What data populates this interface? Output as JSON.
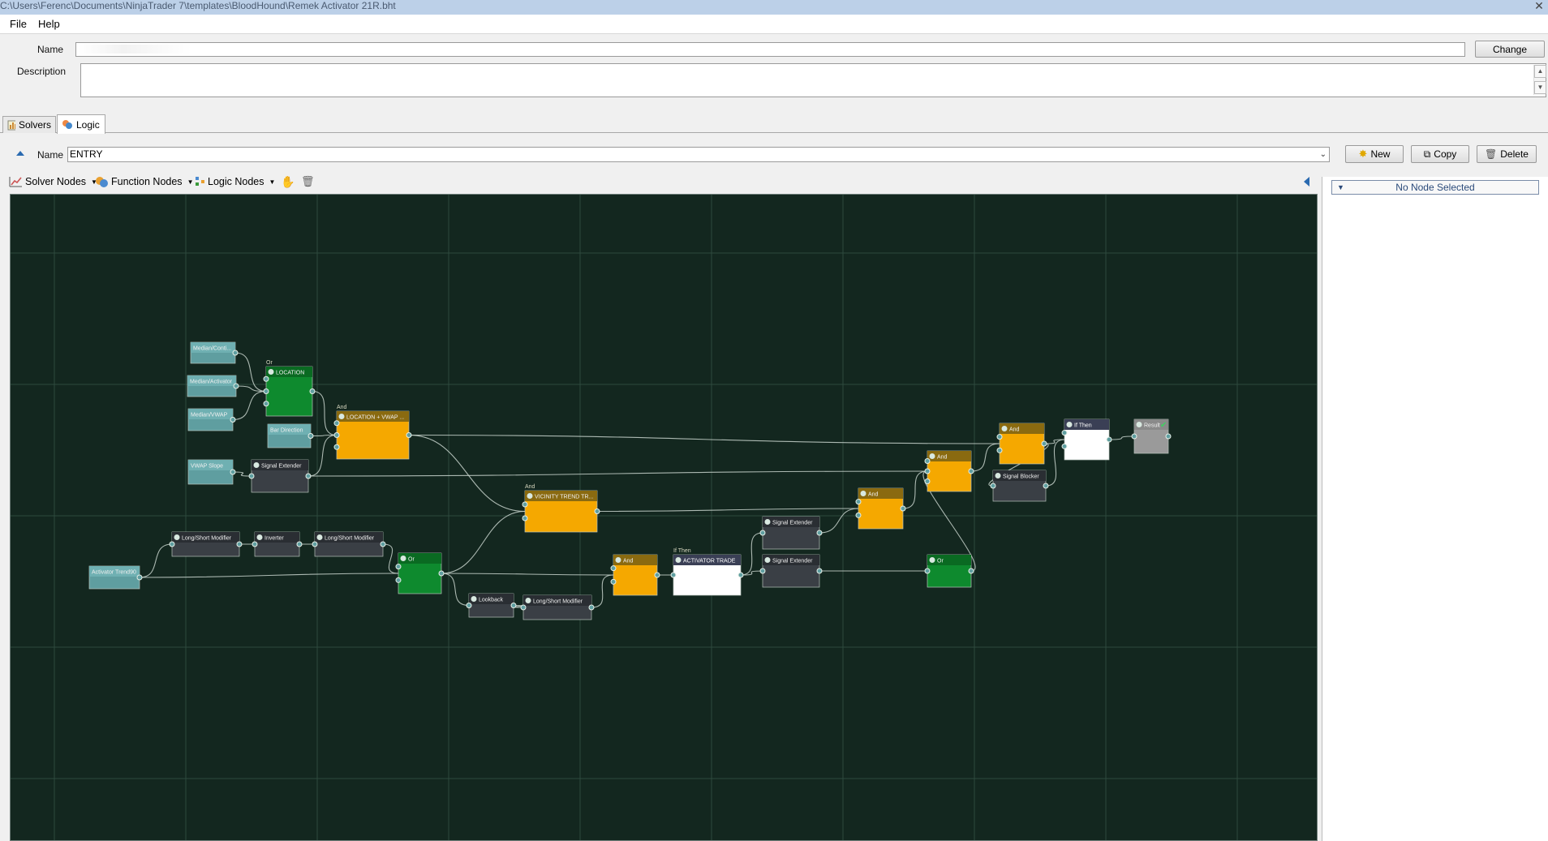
{
  "window": {
    "title": "C:\\Users\\Ferenc\\Documents\\NinjaTrader 7\\templates\\BloodHound\\Remek Activator 21R.bht",
    "close_glyph": "✕"
  },
  "menu": {
    "items": [
      "File",
      "Help"
    ]
  },
  "header": {
    "name_label": "Name",
    "name_value": "",
    "change_label": "Change",
    "description_label": "Description",
    "description_value": ""
  },
  "tabs": [
    {
      "label": "Solvers",
      "active": false
    },
    {
      "label": "Logic",
      "active": true
    }
  ],
  "logic": {
    "name_label": "Name",
    "name_value": "ENTRY",
    "new_label": "New",
    "copy_label": "Copy",
    "delete_label": "Delete"
  },
  "toolbar": {
    "solver_nodes": "Solver Nodes",
    "function_nodes": "Function Nodes",
    "logic_nodes": "Logic Nodes"
  },
  "right_panel": {
    "selection_text": "No Node Selected"
  },
  "colors": {
    "canvas_bg": "#13271f",
    "grid": "#2e4a3e",
    "teal_node": "#5f9ea0",
    "dark_node": "#3a3f45",
    "green_node": "#0e8a2e",
    "orange_node": "#f5a800",
    "white_node": "#ffffff",
    "gray_node": "#9a9a9a",
    "wire": "#c8d4cc"
  },
  "graph": {
    "nodes": [
      {
        "id": "n1",
        "kind": "teal",
        "title": "Median/Conti...",
        "top_label": ""
      },
      {
        "id": "n2",
        "kind": "teal",
        "title": "Median/Activator",
        "top_label": ""
      },
      {
        "id": "n3",
        "kind": "teal",
        "title": "Median/VWAP",
        "top_label": ""
      },
      {
        "id": "n4",
        "kind": "green",
        "title": "LOCATION",
        "top_label": "Or"
      },
      {
        "id": "n5",
        "kind": "teal",
        "title": "Bar Direction",
        "top_label": ""
      },
      {
        "id": "n6",
        "kind": "orange",
        "title": "LOCATION + VWAP ...",
        "top_label": "And"
      },
      {
        "id": "n7",
        "kind": "teal",
        "title": "VWAP Slope",
        "top_label": ""
      },
      {
        "id": "n8",
        "kind": "dark",
        "title": "Signal Extender",
        "top_label": ""
      },
      {
        "id": "n9",
        "kind": "teal",
        "title": "Activator Trend90",
        "top_label": ""
      },
      {
        "id": "n10",
        "kind": "dark",
        "title": "Long/Short Modifier",
        "top_label": ""
      },
      {
        "id": "n11",
        "kind": "dark",
        "title": "Inverter",
        "top_label": ""
      },
      {
        "id": "n12",
        "kind": "dark",
        "title": "Long/Short Modifier",
        "top_label": ""
      },
      {
        "id": "n13",
        "kind": "green",
        "title": "Or",
        "top_label": ""
      },
      {
        "id": "n14",
        "kind": "dark",
        "title": "Lookback",
        "top_label": ""
      },
      {
        "id": "n15",
        "kind": "dark",
        "title": "Long/Short Modifier",
        "top_label": ""
      },
      {
        "id": "n16",
        "kind": "orange",
        "title": "VICINITY TREND TR...",
        "top_label": "And"
      },
      {
        "id": "n17",
        "kind": "orange",
        "title": "And",
        "top_label": ""
      },
      {
        "id": "n18",
        "kind": "white",
        "title": "ACTIVATOR TRADE",
        "top_label": "If Then"
      },
      {
        "id": "n19",
        "kind": "dark",
        "title": "Signal Extender",
        "top_label": ""
      },
      {
        "id": "n20",
        "kind": "dark",
        "title": "Signal Extender",
        "top_label": ""
      },
      {
        "id": "n21",
        "kind": "orange",
        "title": "And",
        "top_label": ""
      },
      {
        "id": "n22",
        "kind": "orange",
        "title": "And",
        "top_label": ""
      },
      {
        "id": "n23",
        "kind": "green",
        "title": "Or",
        "top_label": ""
      },
      {
        "id": "n24",
        "kind": "orange",
        "title": "And",
        "top_label": ""
      },
      {
        "id": "n25",
        "kind": "dark",
        "title": "Signal Blocker",
        "top_label": ""
      },
      {
        "id": "n26",
        "kind": "white",
        "title": "If Then",
        "top_label": ""
      },
      {
        "id": "n27",
        "kind": "gray",
        "title": "Result",
        "top_label": ""
      }
    ],
    "edges": [
      [
        "n1",
        "n4"
      ],
      [
        "n2",
        "n4"
      ],
      [
        "n3",
        "n4"
      ],
      [
        "n4",
        "n6"
      ],
      [
        "n5",
        "n6"
      ],
      [
        "n8",
        "n6"
      ],
      [
        "n7",
        "n8"
      ],
      [
        "n9",
        "n10"
      ],
      [
        "n10",
        "n11"
      ],
      [
        "n11",
        "n12"
      ],
      [
        "n12",
        "n13"
      ],
      [
        "n9",
        "n13"
      ],
      [
        "n13",
        "n16"
      ],
      [
        "n6",
        "n16"
      ],
      [
        "n13",
        "n17"
      ],
      [
        "n13",
        "n14"
      ],
      [
        "n14",
        "n15"
      ],
      [
        "n15",
        "n17"
      ],
      [
        "n17",
        "n18"
      ],
      [
        "n18",
        "n19"
      ],
      [
        "n18",
        "n20"
      ],
      [
        "n16",
        "n21"
      ],
      [
        "n19",
        "n21"
      ],
      [
        "n8",
        "n22"
      ],
      [
        "n21",
        "n22"
      ],
      [
        "n20",
        "n23"
      ],
      [
        "n6",
        "n24"
      ],
      [
        "n22",
        "n24"
      ],
      [
        "n23",
        "n22"
      ],
      [
        "n24",
        "n26"
      ],
      [
        "n25",
        "n26"
      ],
      [
        "n24",
        "n25"
      ],
      [
        "n26",
        "n27"
      ]
    ]
  }
}
